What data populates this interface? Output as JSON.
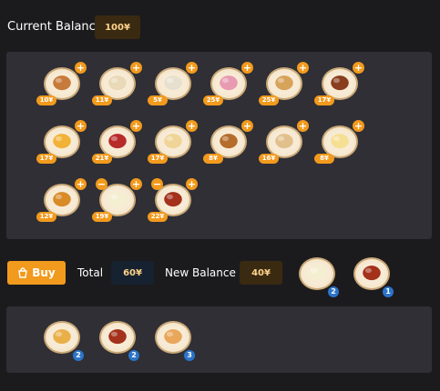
{
  "balance": {
    "label": "Current Balance",
    "value": "100¥"
  },
  "shop_items": [
    {
      "name": "donuts",
      "price": "10¥",
      "icon": "donuts-icon",
      "color": "#c77a3a"
    },
    {
      "name": "bowl",
      "price": "11¥",
      "icon": "bowl-icon",
      "color": "#e9d9b7"
    },
    {
      "name": "dumplings",
      "price": "5¥",
      "icon": "dumplings-icon",
      "color": "#e8e0cf"
    },
    {
      "name": "ice-cream",
      "price": "25¥",
      "icon": "ice-cream-icon",
      "color": "#e89ab1"
    },
    {
      "name": "rolls",
      "price": "25¥",
      "icon": "rolls-icon",
      "color": "#d7a35b"
    },
    {
      "name": "stew",
      "price": "17¥",
      "icon": "stew-icon",
      "color": "#8a3e1e"
    },
    {
      "name": "omelette",
      "price": "17¥",
      "icon": "omelette-icon",
      "color": "#f1b236"
    },
    {
      "name": "steak",
      "price": "21¥",
      "icon": "steak-icon",
      "color": "#b82b2b"
    },
    {
      "name": "pancakes",
      "price": "17¥",
      "icon": "pancakes-icon",
      "color": "#f0d497"
    },
    {
      "name": "roast-chicken",
      "price": "8¥",
      "icon": "roast-chicken-icon",
      "color": "#b56d2c"
    },
    {
      "name": "ramen",
      "price": "16¥",
      "icon": "ramen-icon",
      "color": "#e2c08c"
    },
    {
      "name": "popcorn",
      "price": "8¥",
      "icon": "popcorn-icon",
      "color": "#f4df93"
    },
    {
      "name": "flan",
      "price": "12¥",
      "icon": "flan-icon",
      "color": "#d88b27"
    },
    {
      "name": "cheesecake",
      "price": "19¥",
      "icon": "cheesecake-icon",
      "color": "#f5efd2",
      "has_minus": true
    },
    {
      "name": "meatballs",
      "price": "22¥",
      "icon": "meatballs-icon",
      "color": "#a4311b",
      "has_minus": true
    }
  ],
  "cart_bar": {
    "buy_label": "Buy",
    "total_label": "Total",
    "total_value": "60¥",
    "new_balance_label": "New Balance",
    "new_balance_value": "40¥"
  },
  "cart_items": [
    {
      "name": "cheesecake",
      "count": "2",
      "icon": "cheesecake-icon",
      "color": "#f5efd2"
    },
    {
      "name": "meatballs",
      "count": "1",
      "icon": "meatballs-icon",
      "color": "#a4311b"
    }
  ],
  "inventory_items": [
    {
      "name": "pie",
      "count": "2",
      "icon": "pie-icon",
      "color": "#e9b04a"
    },
    {
      "name": "meatballs",
      "count": "2",
      "icon": "meatballs-icon",
      "color": "#a4311b"
    },
    {
      "name": "sandwich",
      "count": "3",
      "icon": "sandwich-icon",
      "color": "#e8a75a"
    }
  ]
}
